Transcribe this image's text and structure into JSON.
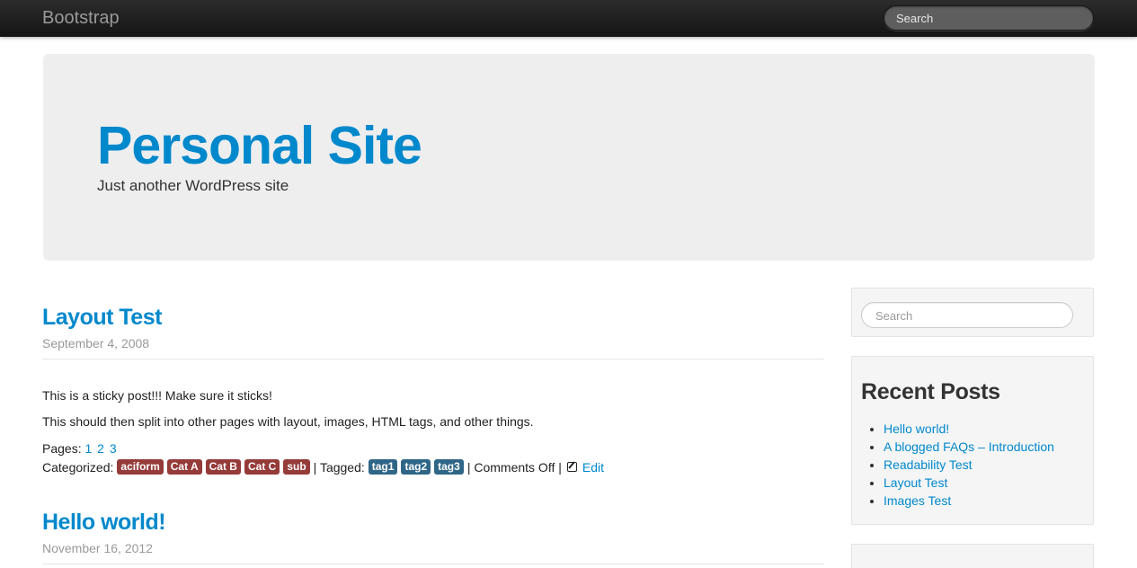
{
  "navbar": {
    "brand": "Bootstrap",
    "search_placeholder": "Search"
  },
  "hero": {
    "title": "Personal Site",
    "subtitle": "Just another WordPress site"
  },
  "posts": [
    {
      "title": "Layout Test",
      "date": "September 4, 2008",
      "paragraphs": [
        "This is a sticky post!!! Make sure it sticks!",
        "This should then split into other pages with layout, images, HTML tags, and other things."
      ],
      "pages_label": "Pages:",
      "pages": [
        "1",
        "2",
        "3"
      ],
      "categorized_label": "Categorized:",
      "categories": [
        "aciform",
        "Cat A",
        "Cat B",
        "Cat C",
        "sub"
      ],
      "tagged_label": "| Tagged:",
      "tags": [
        "tag1",
        "tag2",
        "tag3"
      ],
      "comments": "| Comments Off |",
      "edit_label": "Edit"
    },
    {
      "title": "Hello world!",
      "date": "November 16, 2012"
    }
  ],
  "sidebar": {
    "search_placeholder": "Search",
    "recent_posts": {
      "heading": "Recent Posts",
      "items": [
        "Hello world!",
        "A blogged FAQs – Introduction",
        "Readability Test",
        "Layout Test",
        "Images Test"
      ]
    }
  },
  "colors": {
    "link": "#0088cc",
    "category_label": "#953b39",
    "tag_label": "#2f6688",
    "hero_bg": "#eeeeee"
  }
}
